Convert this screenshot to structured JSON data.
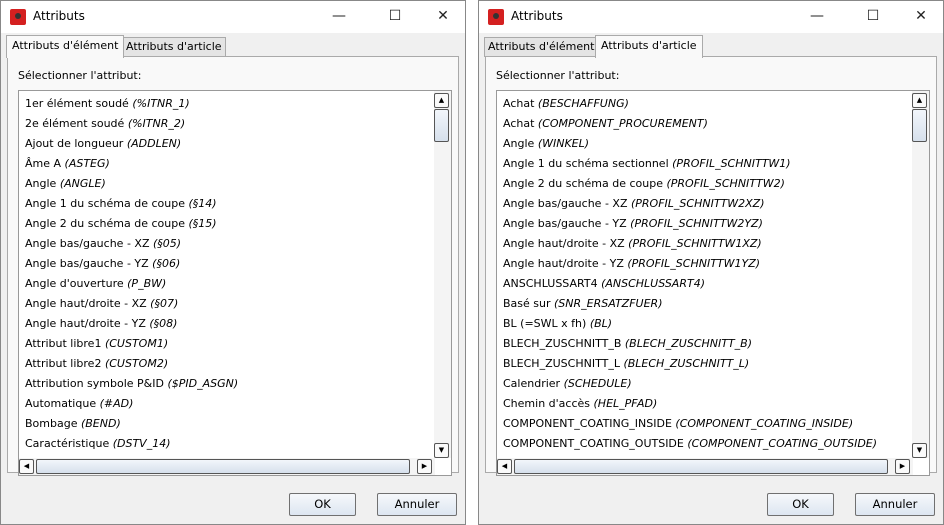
{
  "windows": [
    {
      "title": "Attributs",
      "tabs": [
        {
          "label": "Attributs d'élément",
          "active": true
        },
        {
          "label": "Attributs d'article",
          "active": false
        }
      ],
      "prompt": "Sélectionner l'attribut:",
      "items": [
        {
          "name": "1er élément soudé",
          "code": "(%ITNR_1)"
        },
        {
          "name": "2e élément soudé",
          "code": "(%ITNR_2)"
        },
        {
          "name": "Ajout de longueur",
          "code": "(ADDLEN)"
        },
        {
          "name": "Âme A",
          "code": "(ASTEG)"
        },
        {
          "name": "Angle",
          "code": "(ANGLE)"
        },
        {
          "name": "Angle 1 du schéma de coupe",
          "code": "(§14)"
        },
        {
          "name": "Angle 2 du schéma de coupe",
          "code": "(§15)"
        },
        {
          "name": "Angle bas/gauche - XZ",
          "code": "(§05)"
        },
        {
          "name": "Angle bas/gauche - YZ",
          "code": "(§06)"
        },
        {
          "name": "Angle d'ouverture",
          "code": "(P_BW)"
        },
        {
          "name": "Angle haut/droite - XZ",
          "code": "(§07)"
        },
        {
          "name": "Angle haut/droite - YZ",
          "code": "(§08)"
        },
        {
          "name": "Attribut libre1",
          "code": "(CUSTOM1)"
        },
        {
          "name": "Attribut libre2",
          "code": "(CUSTOM2)"
        },
        {
          "name": "Attribution symbole P&ID",
          "code": "($PID_ASGN)"
        },
        {
          "name": "Automatique",
          "code": "(#AD)"
        },
        {
          "name": "Bombage",
          "code": "(BEND)"
        },
        {
          "name": "Caractéristique",
          "code": "(DSTV_14)"
        }
      ],
      "ok": "OK",
      "cancel": "Annuler"
    },
    {
      "title": "Attributs",
      "tabs": [
        {
          "label": "Attributs d'élément",
          "active": false
        },
        {
          "label": "Attributs d'article",
          "active": true
        }
      ],
      "prompt": "Sélectionner l'attribut:",
      "items": [
        {
          "name": "Achat",
          "code": "(BESCHAFFUNG)"
        },
        {
          "name": "Achat",
          "code": "(COMPONENT_PROCUREMENT)"
        },
        {
          "name": "Angle",
          "code": "(WINKEL)"
        },
        {
          "name": "Angle 1 du schéma sectionnel",
          "code": "(PROFIL_SCHNITTW1)"
        },
        {
          "name": "Angle 2 du schéma de coupe",
          "code": "(PROFIL_SCHNITTW2)"
        },
        {
          "name": "Angle bas/gauche - XZ",
          "code": "(PROFIL_SCHNITTW2XZ)"
        },
        {
          "name": "Angle bas/gauche - YZ",
          "code": "(PROFIL_SCHNITTW2YZ)"
        },
        {
          "name": "Angle haut/droite - XZ",
          "code": "(PROFIL_SCHNITTW1XZ)"
        },
        {
          "name": "Angle haut/droite - YZ",
          "code": "(PROFIL_SCHNITTW1YZ)"
        },
        {
          "name": "ANSCHLUSSART4",
          "code": "(ANSCHLUSSART4)"
        },
        {
          "name": "Basé sur",
          "code": "(SNR_ERSATZFUER)"
        },
        {
          "name": "BL (=SWL x fh)",
          "code": "(BL)"
        },
        {
          "name": "BLECH_ZUSCHNITT_B",
          "code": "(BLECH_ZUSCHNITT_B)"
        },
        {
          "name": "BLECH_ZUSCHNITT_L",
          "code": "(BLECH_ZUSCHNITT_L)"
        },
        {
          "name": "Calendrier",
          "code": "(SCHEDULE)"
        },
        {
          "name": "Chemin d'accès",
          "code": "(HEL_PFAD)"
        },
        {
          "name": "COMPONENT_COATING_INSIDE",
          "code": "(COMPONENT_COATING_INSIDE)"
        },
        {
          "name": "COMPONENT_COATING_OUTSIDE",
          "code": "(COMPONENT_COATING_OUTSIDE)"
        }
      ],
      "ok": "OK",
      "cancel": "Annuler"
    }
  ]
}
